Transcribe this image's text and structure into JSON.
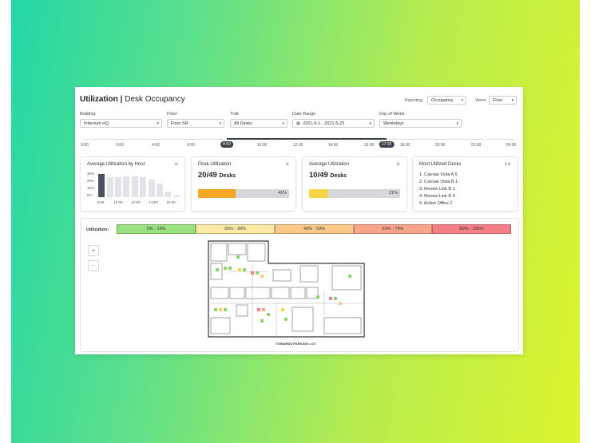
{
  "header": {
    "title_main": "Utilization",
    "title_sep": "|",
    "title_sub": "Desk Occupancy",
    "reporting_label": "Reporting",
    "reporting_value": "Occupancy",
    "views_label": "Views",
    "views_value": "Floor"
  },
  "filters": {
    "building": {
      "label": "Building",
      "value": "Interoum HQ"
    },
    "floor": {
      "label": "Floor",
      "value": "Floor SR"
    },
    "trait": {
      "label": "Trait",
      "value": "All Desks"
    },
    "date_range": {
      "label": "Date Range",
      "value": "2021-5-1 - 2021-5-23"
    },
    "day_of_week": {
      "label": "Day of Week",
      "value": "Weekdays"
    }
  },
  "timeline": {
    "ticks": [
      "0:00",
      "2:00",
      "4:00",
      "6:00",
      "10:00",
      "12:00",
      "14:00",
      "16:00",
      "18:00",
      "20:00",
      "22:00",
      "24:00"
    ],
    "start_handle": "8:00",
    "end_handle": "17:00"
  },
  "cards": {
    "avg_by_hour": {
      "title": "Average Utilization by Hour",
      "y_ticks": [
        "30%",
        "20%",
        "10%",
        "0%"
      ],
      "x_ticks": [
        "8:00",
        "10:00",
        "12:00",
        "14:00",
        "16:00"
      ]
    },
    "peak": {
      "title": "Peak Utilization",
      "value": "20/49",
      "unit": "Desks",
      "percent_label": "41%",
      "percent": 41,
      "color": "#f5a623"
    },
    "average": {
      "title": "Average Utilization",
      "value": "10/49",
      "unit": "Desks",
      "percent_label": "21%",
      "percent": 21,
      "color": "#f9d648"
    },
    "most_utilized": {
      "title": "Most Utilized Desks",
      "items": [
        "1. Canvas Vista A 5",
        "2. Canvas Vista B 1",
        "3. Renew Link B 1",
        "4. Renew Link B 5",
        "5. Action Office 2"
      ]
    }
  },
  "chart_data": {
    "type": "bar",
    "title": "Average Utilization by Hour",
    "categories": [
      "8:00",
      "9:00",
      "10:00",
      "11:00",
      "12:00",
      "13:00",
      "14:00",
      "15:00",
      "16:00",
      "17:00"
    ],
    "values": [
      29,
      25,
      25,
      26,
      26,
      25,
      22,
      17,
      7,
      2
    ],
    "ylim": [
      0,
      30
    ],
    "highlight_index": 0
  },
  "map": {
    "legend_label": "Utilization:",
    "legend": [
      {
        "label": "0% - 19%",
        "color": "#9be07e"
      },
      {
        "label": "20% - 39%",
        "color": "#fbe9a6"
      },
      {
        "label": "40% - 59%",
        "color": "#fdc98a"
      },
      {
        "label": "60% - 79%",
        "color": "#f9a58b"
      },
      {
        "label": "80% - 100%",
        "color": "#f47f84"
      }
    ],
    "zoom_in": "+",
    "zoom_out": "-",
    "footer_label": "TOWARDS PARKING LOT"
  }
}
